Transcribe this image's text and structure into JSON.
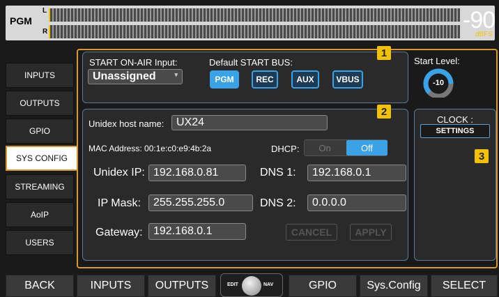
{
  "meter": {
    "bus_label": "PGM",
    "left_label": "L",
    "right_label": "R",
    "db_value": "-90",
    "db_unit": "dBFS"
  },
  "sidebar": {
    "items": [
      {
        "label": "INPUTS"
      },
      {
        "label": "OUTPUTS"
      },
      {
        "label": "GPIO"
      },
      {
        "label": "SYS CONFIG"
      },
      {
        "label": "STREAMING"
      },
      {
        "label": "AoIP"
      },
      {
        "label": "USERS"
      }
    ]
  },
  "onair": {
    "input_label": "START ON-AIR Input:",
    "input_value": "Unassigned",
    "bus_label": "Default START BUS:",
    "buses": [
      "PGM",
      "REC",
      "AUX",
      "VBUS"
    ],
    "selected_bus": "PGM",
    "badge": "1",
    "start_level_label": "Start Level:",
    "start_level_value": "-10"
  },
  "network": {
    "badge": "2",
    "host_label": "Unidex host name:",
    "host_value": "UX24",
    "mac_label": "MAC Address: 00:1e:c0:e9:4b:2a",
    "dhcp_label": "DHCP:",
    "dhcp_on": "On",
    "dhcp_off": "Off",
    "ip_label": "Unidex IP:",
    "ip_value": "192.168.0.81",
    "mask_label": "IP Mask:",
    "mask_value": "255.255.255.0",
    "gateway_label": "Gateway:",
    "gateway_value": "192.168.0.1",
    "dns1_label": "DNS 1:",
    "dns1_value": "192.168.0.1",
    "dns2_label": "DNS 2:",
    "dns2_value": "0.0.0.0",
    "cancel_label": "CANCEL",
    "apply_label": "APPLY"
  },
  "clock": {
    "title": "CLOCK :",
    "settings_label": "SETTINGS",
    "badge": "3"
  },
  "bottom": {
    "back": "BACK",
    "inputs": "INPUTS",
    "outputs": "OUTPUTS",
    "edit": "EDIT",
    "nav": "NAV",
    "gpio": "GPIO",
    "sysconfig": "Sys.Config",
    "select": "SELECT"
  },
  "colors": {
    "accent": "#3aa2e6",
    "highlight": "#f2c200",
    "frame": "#d99a2b"
  }
}
